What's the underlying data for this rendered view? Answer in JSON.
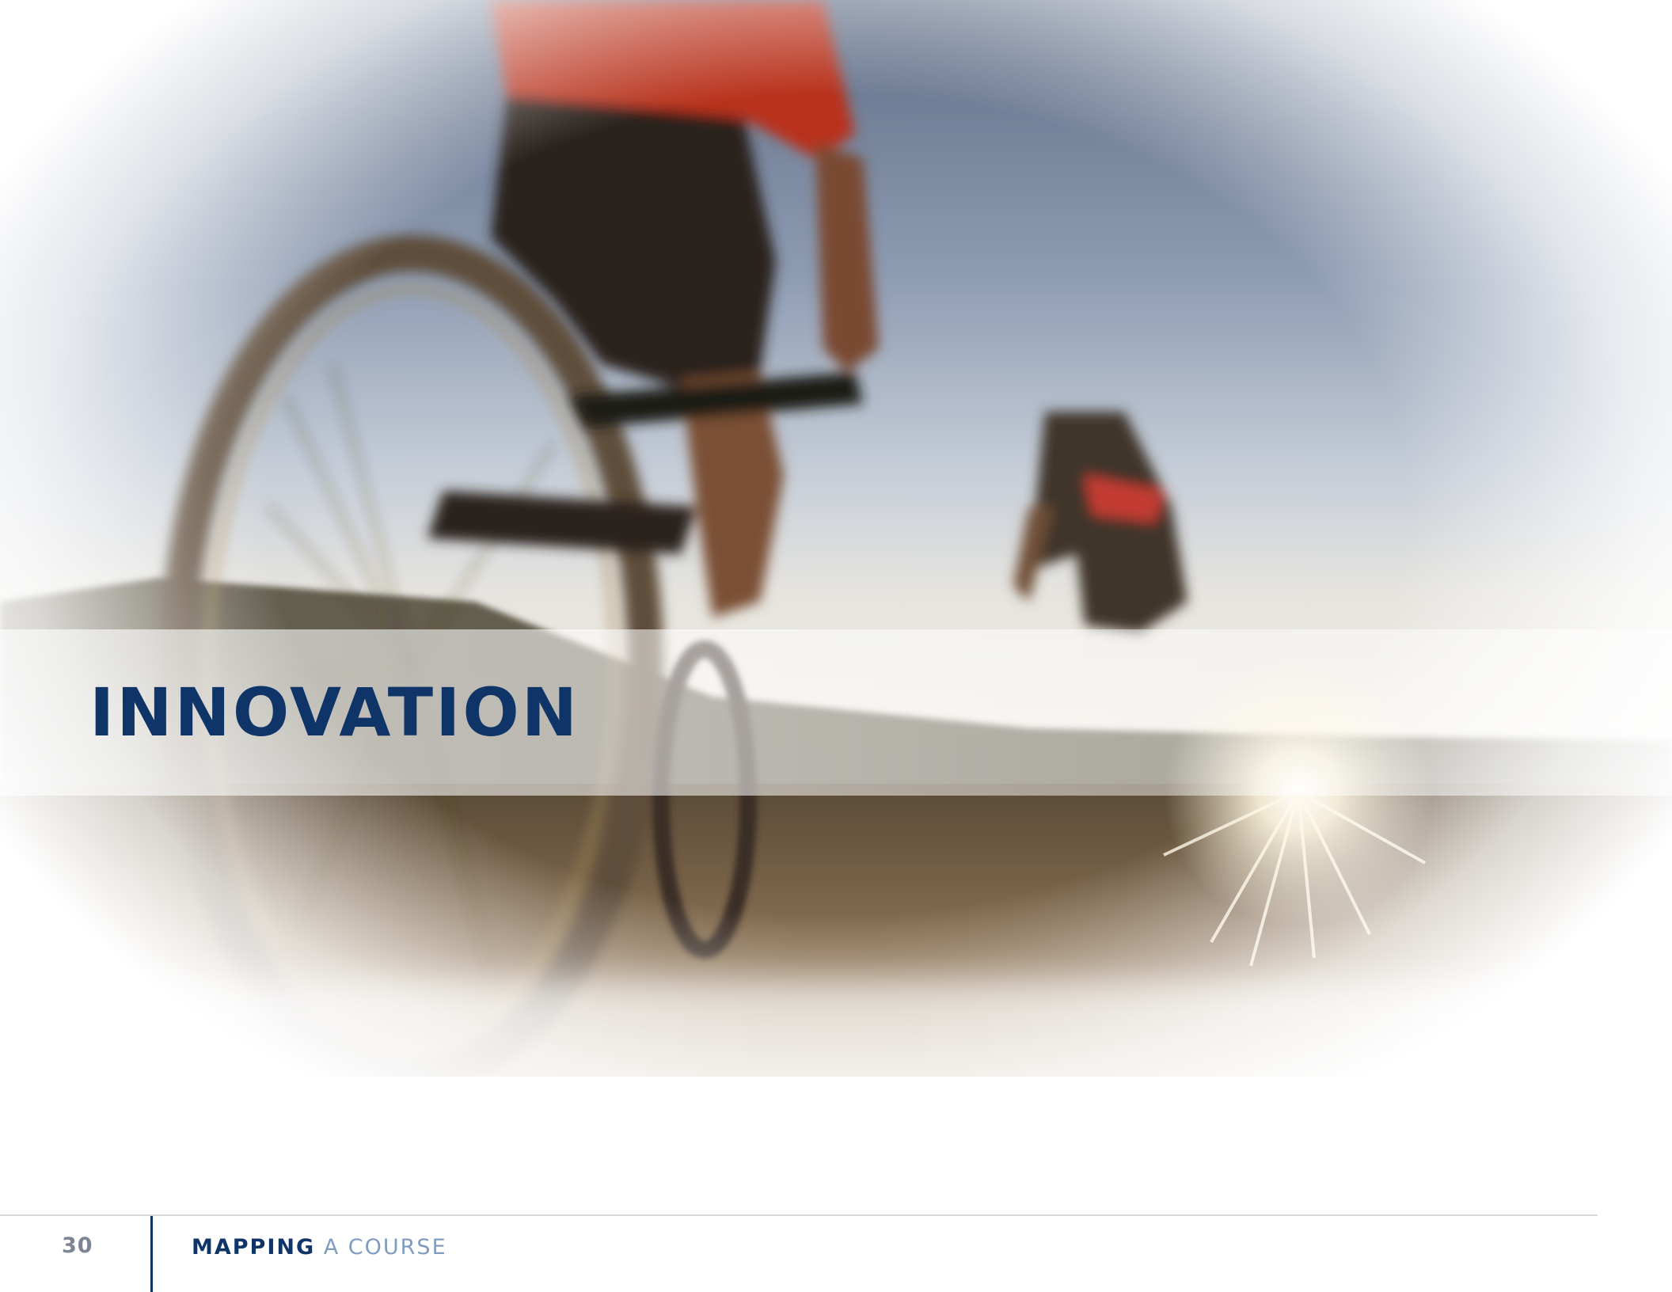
{
  "photo": {
    "description_icon": "cyclist-photo"
  },
  "title": "INNOVATION",
  "footer": {
    "page_number": "30",
    "running_head_strong": "MAPPING",
    "running_head_light": "A COURSE"
  },
  "colors": {
    "brand_navy": "#0e3468",
    "running_head_light": "#7f9cc0",
    "page_number_gray": "#7b8594",
    "rule_gray": "#d6d9de"
  }
}
